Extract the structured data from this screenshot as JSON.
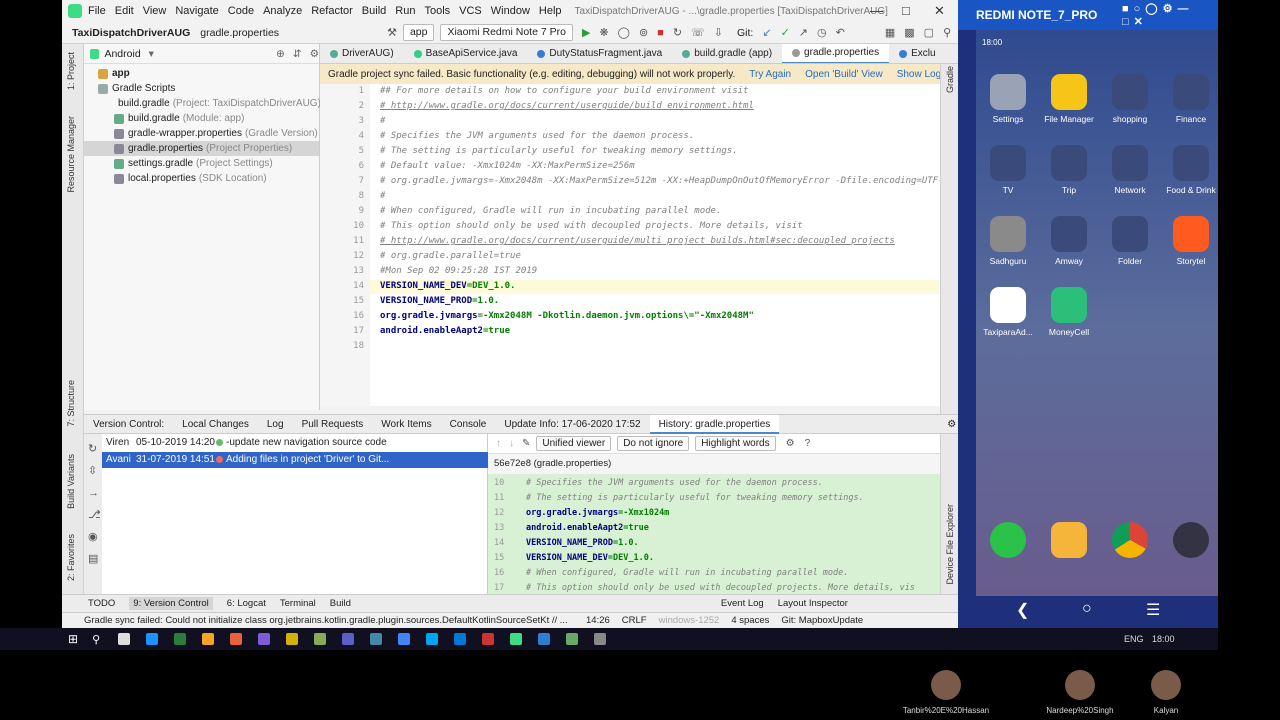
{
  "menu": {
    "items": [
      "File",
      "Edit",
      "View",
      "Navigate",
      "Code",
      "Analyze",
      "Refactor",
      "Build",
      "Run",
      "Tools",
      "VCS",
      "Window",
      "Help"
    ],
    "window_title": "TaxiDispatchDriverAUG - ...\\gradle.properties [TaxiDispatchDriverAUG]"
  },
  "nav": {
    "project": "TaxiDispatchDriverAUG",
    "file": "gradle.properties",
    "run_config": "app",
    "device": "Xiaomi Redmi Note 7 Pro",
    "git": "Git:"
  },
  "project_panel": {
    "view": "Android",
    "tree": [
      {
        "label": "app",
        "hint": ""
      },
      {
        "label": "Gradle Scripts",
        "hint": ""
      },
      {
        "label": "build.gradle",
        "hint": "(Project: TaxiDispatchDriverAUG)"
      },
      {
        "label": "build.gradle",
        "hint": "(Module: app)"
      },
      {
        "label": "gradle-wrapper.properties",
        "hint": "(Gradle Version)"
      },
      {
        "label": "gradle.properties",
        "hint": "(Project Properties)"
      },
      {
        "label": "settings.gradle",
        "hint": "(Project Settings)"
      },
      {
        "label": "local.properties",
        "hint": "(SDK Location)"
      }
    ]
  },
  "side_labels": {
    "project": "1: Project",
    "resource": "Resource Manager",
    "structure": "7: Structure",
    "variants": "Build Variants",
    "favorites": "2: Favorites",
    "gradle": "Gradle",
    "device_explorer": "Device File Explorer"
  },
  "editor_tabs": [
    {
      "label": "DriverAUG)",
      "color": "#5a9"
    },
    {
      "label": "BaseApiService.java",
      "color": "#3c8"
    },
    {
      "label": "DutyStatusFragment.java",
      "color": "#3a7bd5"
    },
    {
      "label": "build.gradle (app)",
      "color": "#5a9"
    },
    {
      "label": "gradle.properties",
      "color": "#999"
    },
    {
      "label": "Exclu",
      "color": "#3a7bd5"
    }
  ],
  "banner": {
    "message": "Gradle project sync failed. Basic functionality (e.g. editing, debugging) will not work properly.",
    "try_again": "Try Again",
    "open_build": "Open 'Build' View",
    "show_log": "Show Log in Explorer"
  },
  "code_lines": [
    {
      "n": "1",
      "t": "## For more details on how to configure your build environment visit",
      "c": "cm"
    },
    {
      "n": "2",
      "t": "# http://www.gradle.org/docs/current/userguide/build_environment.html",
      "c": "cu"
    },
    {
      "n": "3",
      "t": "#",
      "c": "cm"
    },
    {
      "n": "4",
      "t": "# Specifies the JVM arguments used for the daemon process.",
      "c": "cm"
    },
    {
      "n": "5",
      "t": "# The setting is particularly useful for tweaking memory settings.",
      "c": "cm"
    },
    {
      "n": "6",
      "t": "# Default value: -Xmx1024m -XX:MaxPermSize=256m",
      "c": "cm"
    },
    {
      "n": "7",
      "t": "# org.gradle.jvmargs=-Xmx2048m -XX:MaxPermSize=512m -XX:+HeapDumpOnOutOfMemoryError -Dfile.encoding=UTF-8",
      "c": "cm"
    },
    {
      "n": "8",
      "t": "#",
      "c": "cm"
    },
    {
      "n": "9",
      "t": "# When configured, Gradle will run in incubating parallel mode.",
      "c": "cm"
    },
    {
      "n": "10",
      "t": "# This option should only be used with decoupled projects. More details, visit",
      "c": "cm"
    },
    {
      "n": "11",
      "t": "# http://www.gradle.org/docs/current/userguide/multi_project_builds.html#sec:decoupled_projects",
      "c": "cu"
    },
    {
      "n": "12",
      "t": "# org.gradle.parallel=true",
      "c": "cm"
    },
    {
      "n": "13",
      "t": "#Mon Sep 02 09:25:28 IST 2019",
      "c": "cm"
    },
    {
      "n": "14",
      "k": "VERSION_NAME_DEV",
      "v": "=DEV_1.0."
    },
    {
      "n": "15",
      "k": "VERSION_NAME_PROD",
      "v": "=1.0."
    },
    {
      "n": "16",
      "k": "org.gradle.jvmargs",
      "v": "=-Xmx2048M -Dkotlin.daemon.jvm.options\\=\"-Xmx2048M\""
    },
    {
      "n": "17",
      "k": "android.enableAapt2",
      "v": "=true"
    },
    {
      "n": "18",
      "t": "",
      "c": "cm"
    }
  ],
  "vcs": {
    "label": "Version Control:",
    "tabs": [
      "Local Changes",
      "Log",
      "Pull Requests",
      "Work Items",
      "Console",
      "Update Info: 17-06-2020 17:52",
      "History: gradle.properties"
    ],
    "rows": [
      {
        "author": "Viren",
        "date": "05-10-2019 14:20",
        "msg": "-update new navigation source code"
      },
      {
        "author": "Avani",
        "date": "31-07-2019 14:51",
        "msg": "Adding files in project 'Driver' to Git..."
      }
    ],
    "viewer": "Unified viewer",
    "ignore": "Do not ignore",
    "highlight": "Highlight words",
    "revision": "56e72e8 (gradle.properties)"
  },
  "diff_lines": [
    {
      "n": "10",
      "t": "# Specifies the JVM arguments used for the daemon process.",
      "c": "cm"
    },
    {
      "n": "11",
      "t": "# The setting is particularly useful for tweaking memory settings.",
      "c": "cm"
    },
    {
      "n": "12",
      "k": "org.gradle.jvmargs",
      "v": "=-Xmx1024m"
    },
    {
      "n": "13",
      "k": "android.enableAapt2",
      "v": "=true"
    },
    {
      "n": "14",
      "k": "VERSION_NAME_PROD",
      "v": "=1.0."
    },
    {
      "n": "15",
      "k": "VERSION_NAME_DEV",
      "v": "=DEV_1.0."
    },
    {
      "n": "16",
      "t": "# When configured, Gradle will run in incubating parallel mode.",
      "c": "cm"
    },
    {
      "n": "17",
      "t": "# This option should only be used with decoupled projects. More details, vis",
      "c": "cm"
    }
  ],
  "bottom_tabs": [
    "TODO",
    "9: Version Control",
    "6: Logcat",
    "Terminal",
    "Build"
  ],
  "bottom_right": [
    "Event Log",
    "Layout Inspector"
  ],
  "status": {
    "msg": "Gradle sync failed: Could not initialize class org.jetbrains.kotlin.gradle.plugin.sources.DefaultKotlinSourceSetKt // ... (a minute ago)",
    "pos": "14:26",
    "crlf": "CRLF",
    "enc": "windows-1252",
    "indent": "4 spaces",
    "branch": "Git: MapboxUpdate"
  },
  "phone": {
    "title": "REDMI NOTE_7_PRO",
    "time": "18:00",
    "apps": [
      {
        "label": "Settings",
        "color": "#9aa3b5"
      },
      {
        "label": "File Manager",
        "color": "#f5c518"
      },
      {
        "label": "shopping",
        "color": "#3a4a7a"
      },
      {
        "label": "Finance",
        "color": "#3a4a7a"
      },
      {
        "label": "TV",
        "color": "#3a4a7a"
      },
      {
        "label": "Trip",
        "color": "#3a4a7a"
      },
      {
        "label": "Network",
        "color": "#3a4a7a"
      },
      {
        "label": "Food & Drink",
        "color": "#3a4a7a"
      },
      {
        "label": "Sadhguru",
        "color": "#8a8a8a"
      },
      {
        "label": "Amway",
        "color": "#3a4a7a"
      },
      {
        "label": "Folder",
        "color": "#3a4a7a"
      },
      {
        "label": "Storytel",
        "color": "#ff5a1f"
      },
      {
        "label": "TaxiparaAd...",
        "color": "#ffffff"
      },
      {
        "label": "MoneyCell",
        "color": "#2bbf7a"
      }
    ]
  },
  "taskbar": {
    "lang": "ENG",
    "time": "18:00"
  },
  "participants": [
    "Tanbir%20E%20Hassan",
    "Nardeep%20Singh",
    "Kalyan"
  ]
}
